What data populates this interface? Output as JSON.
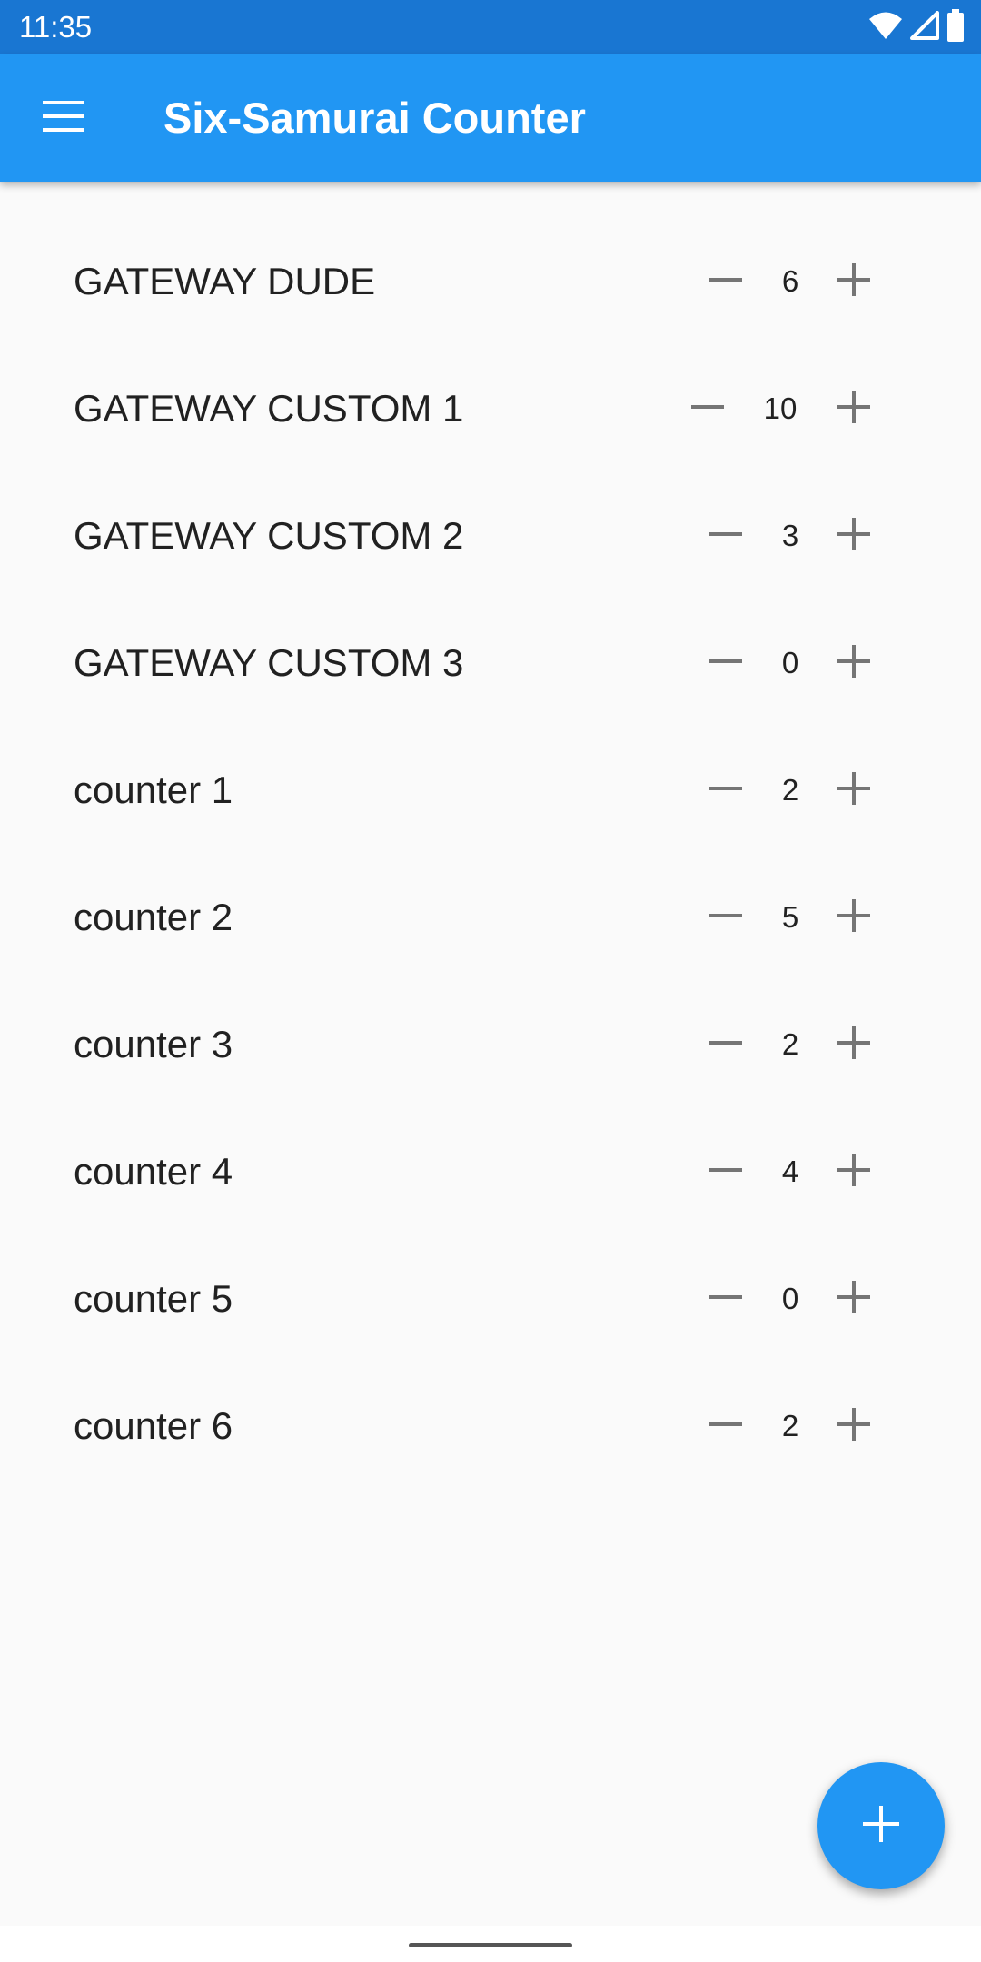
{
  "status_bar": {
    "time": "11:35",
    "icons": [
      "wifi-icon",
      "cell-signal-icon",
      "battery-icon"
    ]
  },
  "app_bar": {
    "title": "Six-Samurai Counter",
    "menu_icon": "menu-icon"
  },
  "counters": [
    {
      "name": "GATEWAY DUDE",
      "value": "6"
    },
    {
      "name": "GATEWAY CUSTOM 1",
      "value": "10"
    },
    {
      "name": "GATEWAY CUSTOM 2",
      "value": "3"
    },
    {
      "name": "GATEWAY CUSTOM 3",
      "value": "0"
    },
    {
      "name": "counter 1",
      "value": "2"
    },
    {
      "name": "counter 2",
      "value": "5"
    },
    {
      "name": "counter 3",
      "value": "2"
    },
    {
      "name": "counter 4",
      "value": "4"
    },
    {
      "name": "counter 5",
      "value": "0"
    },
    {
      "name": "counter 6",
      "value": "2"
    }
  ],
  "fab": {
    "icon": "plus-icon"
  },
  "colors": {
    "status_bar": "#1976d2",
    "app_bar": "#2196f3",
    "fab": "#2196f3",
    "background": "#fafafa",
    "control_icon": "#757575"
  }
}
